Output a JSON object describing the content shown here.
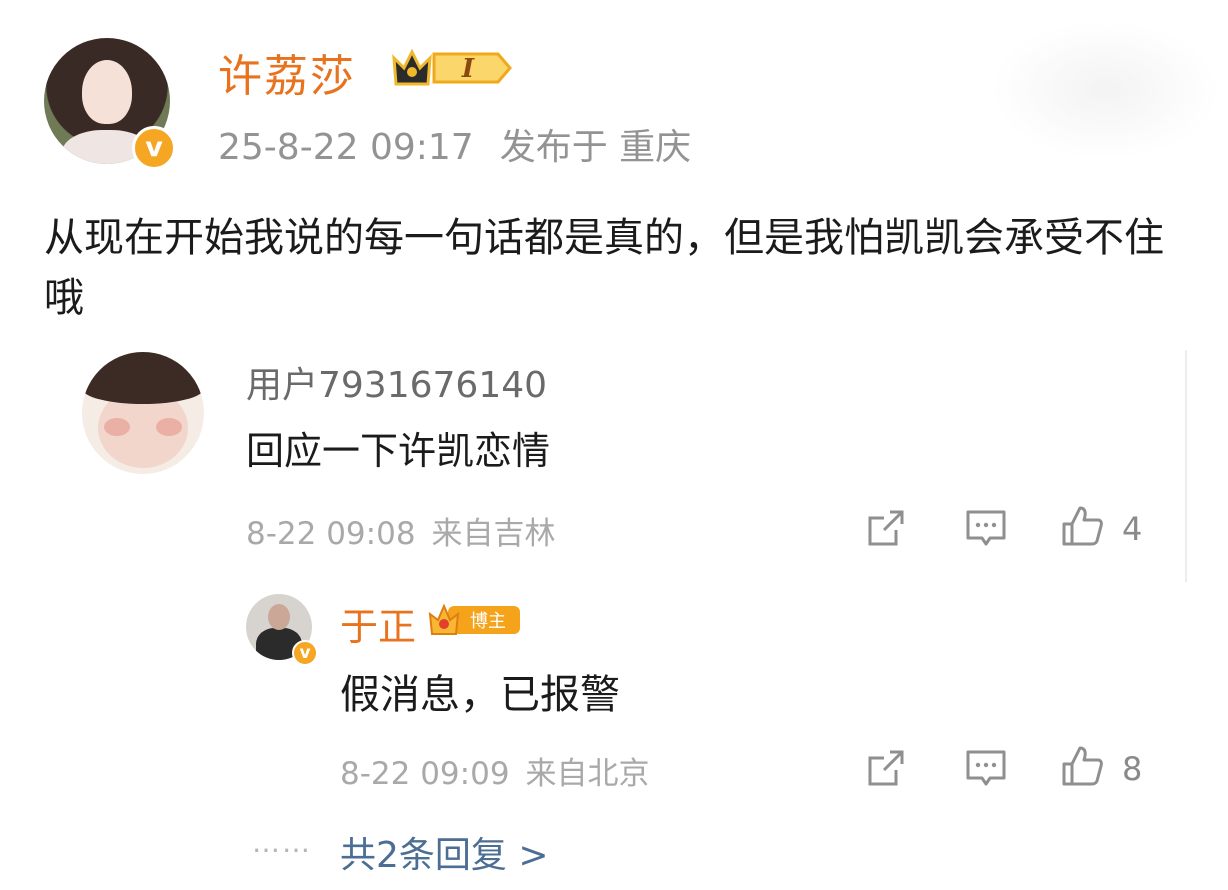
{
  "post": {
    "author": "许荔莎",
    "rank_badge": "I",
    "datetime": "25-8-22 09:17",
    "location": "发布于 重庆",
    "text": "从现在开始我说的每一句话都是真的，但是我怕凯凯会承受不住哦"
  },
  "comment": {
    "username": "用户7931676140",
    "text": "回应一下许凯恋情",
    "time": "8-22 09:08",
    "location": "来自吉林",
    "like_count": "4"
  },
  "reply": {
    "username": "于正",
    "badge_label": "博主",
    "text": "假消息，已报警",
    "time": "8-22 09:09",
    "location": "来自北京",
    "like_count": "8"
  },
  "more_dots": "……",
  "more_replies": "共2条回复 >",
  "colors": {
    "accent_orange": "#e8731f",
    "verified_badge": "#f5a623",
    "link_blue": "#4c6e95",
    "meta_gray": "#a9a9a9"
  },
  "icons": [
    "share-icon",
    "comment-icon",
    "like-icon",
    "verified-badge-icon",
    "crown-icon"
  ]
}
